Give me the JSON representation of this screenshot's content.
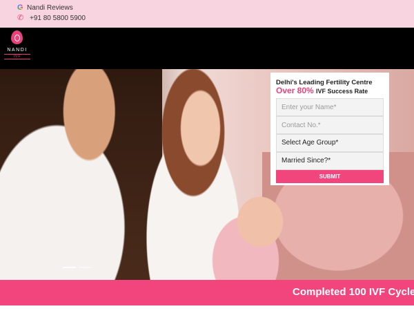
{
  "topbar": {
    "reviews_label": "Nandi Reviews",
    "reviews_icon": "google-icon",
    "phone_number": "+91 80 5800 5900",
    "phone_icon": "phone-icon",
    "background_color": "#f8d3e0"
  },
  "header": {
    "logo": {
      "brand": "NANDI",
      "sub": "IVF"
    },
    "background_color": "#000000"
  },
  "hero": {
    "slider_count": 2,
    "active_slide": 1
  },
  "form": {
    "title": "Delhi's Leading Fertility Centre",
    "rate_highlight": "Over 80%",
    "rate_tail": "IVF Success Rate",
    "name_placeholder": "Enter your Name*",
    "contact_placeholder": "Contact No.*",
    "age_select_label": "Select Age Group*",
    "married_select_label": "Married Since?*",
    "submit_label": "SUBMIT",
    "accent_color": "#e9417a"
  },
  "ribbon": {
    "text": "Completed 100 IVF Cycle",
    "background_color": "#f2457d"
  }
}
